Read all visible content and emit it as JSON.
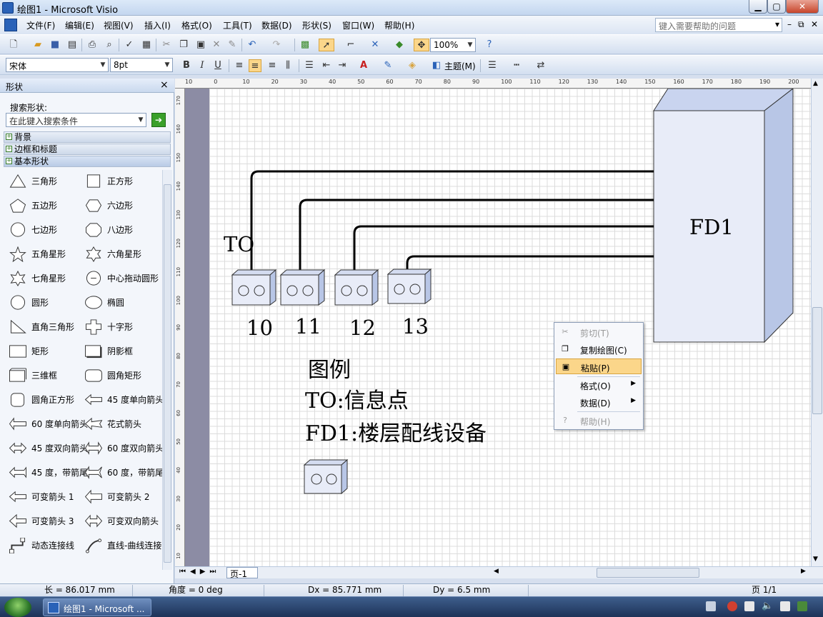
{
  "window": {
    "title": "绘图1 - Microsoft Visio",
    "min": "▁",
    "max": "▢",
    "close": "✕"
  },
  "menubar": {
    "items": [
      "文件(F)",
      "编辑(E)",
      "视图(V)",
      "插入(I)",
      "格式(O)",
      "工具(T)",
      "数据(D)",
      "形状(S)",
      "窗口(W)",
      "帮助(H)"
    ],
    "help_placeholder": "键入需要帮助的问题",
    "doc_controls": [
      "▾",
      "–",
      "⧉",
      "✕"
    ]
  },
  "toolbar1": {
    "zoom": "100%",
    "pointer_icon": "pointer-tool-icon",
    "connector_icon": "connector-tool-icon"
  },
  "toolbar2": {
    "font": "宋体",
    "font_size": "8pt",
    "bold": "B",
    "italic": "I",
    "underline": "U",
    "theme": "主题(M)"
  },
  "shapes_panel": {
    "title": "形状",
    "close": "×",
    "search_label": "搜索形状:",
    "search_placeholder": "在此键入搜索条件",
    "stencils": [
      "背景",
      "边框和标题",
      "基本形状"
    ],
    "shapes": [
      {
        "label": "三角形",
        "icon": "triangle"
      },
      {
        "label": "正方形",
        "icon": "square"
      },
      {
        "label": "五边形",
        "icon": "pentagon"
      },
      {
        "label": "六边形",
        "icon": "hexagon"
      },
      {
        "label": "七边形",
        "icon": "heptagon"
      },
      {
        "label": "八边形",
        "icon": "octagon"
      },
      {
        "label": "五角星形",
        "icon": "star5"
      },
      {
        "label": "六角星形",
        "icon": "star6"
      },
      {
        "label": "七角星形",
        "icon": "star7"
      },
      {
        "label": "中心拖动圆形",
        "icon": "center-circle"
      },
      {
        "label": "圆形",
        "icon": "circle"
      },
      {
        "label": "椭圆",
        "icon": "ellipse"
      },
      {
        "label": "直角三角形",
        "icon": "right-triangle"
      },
      {
        "label": "十字形",
        "icon": "cross"
      },
      {
        "label": "矩形",
        "icon": "rectangle"
      },
      {
        "label": "阴影框",
        "icon": "shadow-box"
      },
      {
        "label": "三维框",
        "icon": "3d-box"
      },
      {
        "label": "圆角矩形",
        "icon": "rounded-rect"
      },
      {
        "label": "圆角正方形",
        "icon": "rounded-square"
      },
      {
        "label": "45 度单向箭头",
        "icon": "arrow-45"
      },
      {
        "label": "60 度单向箭头",
        "icon": "arrow-60"
      },
      {
        "label": "花式箭头",
        "icon": "fancy-arrow"
      },
      {
        "label": "45 度双向箭头",
        "icon": "double-arrow-45"
      },
      {
        "label": "60 度双向箭头",
        "icon": "double-arrow-60"
      },
      {
        "label": "45 度，带箭尾",
        "icon": "tail-arrow-45"
      },
      {
        "label": "60 度，带箭尾",
        "icon": "tail-arrow-60"
      },
      {
        "label": "可变箭头 1",
        "icon": "var-arrow-1"
      },
      {
        "label": "可变箭头 2",
        "icon": "var-arrow-2"
      },
      {
        "label": "可变箭头 3",
        "icon": "var-arrow-3"
      },
      {
        "label": "可变双向箭头",
        "icon": "var-double-arrow"
      },
      {
        "label": "动态连接线",
        "icon": "dynamic-connector"
      },
      {
        "label": "直线-曲线连接线",
        "icon": "line-curve-connector"
      }
    ]
  },
  "rulers": {
    "h_ticks": [
      "10",
      "0",
      "10",
      "20",
      "30",
      "40",
      "50",
      "60",
      "70",
      "80",
      "90",
      "100",
      "110",
      "120",
      "130",
      "140",
      "150",
      "160",
      "170",
      "180",
      "190",
      "200"
    ],
    "v_ticks": [
      "170",
      "160",
      "150",
      "140",
      "130",
      "120",
      "110",
      "100",
      "90",
      "80",
      "70",
      "60",
      "50",
      "40",
      "30",
      "20",
      "10"
    ]
  },
  "drawing": {
    "to_label": "TO",
    "fd_label": "FD1",
    "jacks": [
      "10",
      "11",
      "12",
      "13"
    ],
    "legend_title": "图例",
    "legend_to": "TO:信息点",
    "legend_fd": "FD1:楼层配线设备"
  },
  "context_menu": {
    "items": [
      {
        "label": "剪切(T)",
        "icon": "scissors-icon",
        "enabled": false,
        "submenu": false
      },
      {
        "label": "复制绘图(C)",
        "icon": "copy-icon",
        "enabled": true,
        "submenu": false
      },
      {
        "label": "粘贴(P)",
        "icon": "paste-icon",
        "enabled": true,
        "submenu": false,
        "highlighted": true
      },
      {
        "label": "格式(O)",
        "icon": "",
        "enabled": true,
        "submenu": true
      },
      {
        "label": "数据(D)",
        "icon": "",
        "enabled": true,
        "submenu": true
      },
      {
        "label": "帮助(H)",
        "icon": "help-icon",
        "enabled": false,
        "submenu": false
      }
    ]
  },
  "page_tabs": {
    "tab": "页-1"
  },
  "statusbar": {
    "length": "长 = 86.017 mm",
    "angle": "角度 = 0 deg",
    "dx": "Dx = 85.771 mm",
    "dy": "Dy = 6.5 mm",
    "page": "页 1/1"
  },
  "taskbar": {
    "button": "绘图1 - Microsoft ..."
  },
  "colors": {
    "accent": "#2a62b8",
    "highlight": "#fbd68a",
    "box_front": "#e8ecf8",
    "box_side": "#b8c6e6"
  }
}
